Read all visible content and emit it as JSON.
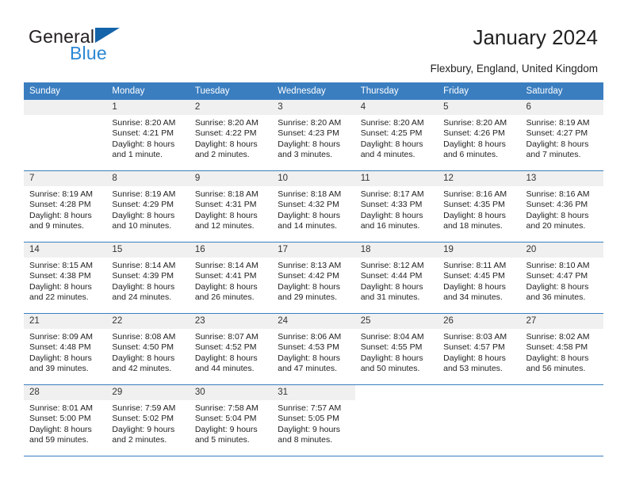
{
  "brand": {
    "name_part1": "General",
    "name_part2": "Blue",
    "flag_icon": "triangle-flag-icon",
    "color_dark": "#231f20",
    "color_blue": "#2b87d4",
    "flag_color": "#1464aa"
  },
  "header": {
    "title": "January 2024",
    "subtitle": "Flexbury, England, United Kingdom",
    "header_bg": "#3a7ec0",
    "daynum_bg": "#f0f0f0"
  },
  "weekdays": [
    "Sunday",
    "Monday",
    "Tuesday",
    "Wednesday",
    "Thursday",
    "Friday",
    "Saturday"
  ],
  "weeks": [
    [
      {
        "day": "",
        "sunrise": "",
        "sunset": "",
        "daylight1": "",
        "daylight2": "",
        "empty": true
      },
      {
        "day": "1",
        "sunrise": "Sunrise: 8:20 AM",
        "sunset": "Sunset: 4:21 PM",
        "daylight1": "Daylight: 8 hours",
        "daylight2": "and 1 minute."
      },
      {
        "day": "2",
        "sunrise": "Sunrise: 8:20 AM",
        "sunset": "Sunset: 4:22 PM",
        "daylight1": "Daylight: 8 hours",
        "daylight2": "and 2 minutes."
      },
      {
        "day": "3",
        "sunrise": "Sunrise: 8:20 AM",
        "sunset": "Sunset: 4:23 PM",
        "daylight1": "Daylight: 8 hours",
        "daylight2": "and 3 minutes."
      },
      {
        "day": "4",
        "sunrise": "Sunrise: 8:20 AM",
        "sunset": "Sunset: 4:25 PM",
        "daylight1": "Daylight: 8 hours",
        "daylight2": "and 4 minutes."
      },
      {
        "day": "5",
        "sunrise": "Sunrise: 8:20 AM",
        "sunset": "Sunset: 4:26 PM",
        "daylight1": "Daylight: 8 hours",
        "daylight2": "and 6 minutes."
      },
      {
        "day": "6",
        "sunrise": "Sunrise: 8:19 AM",
        "sunset": "Sunset: 4:27 PM",
        "daylight1": "Daylight: 8 hours",
        "daylight2": "and 7 minutes."
      }
    ],
    [
      {
        "day": "7",
        "sunrise": "Sunrise: 8:19 AM",
        "sunset": "Sunset: 4:28 PM",
        "daylight1": "Daylight: 8 hours",
        "daylight2": "and 9 minutes."
      },
      {
        "day": "8",
        "sunrise": "Sunrise: 8:19 AM",
        "sunset": "Sunset: 4:29 PM",
        "daylight1": "Daylight: 8 hours",
        "daylight2": "and 10 minutes."
      },
      {
        "day": "9",
        "sunrise": "Sunrise: 8:18 AM",
        "sunset": "Sunset: 4:31 PM",
        "daylight1": "Daylight: 8 hours",
        "daylight2": "and 12 minutes."
      },
      {
        "day": "10",
        "sunrise": "Sunrise: 8:18 AM",
        "sunset": "Sunset: 4:32 PM",
        "daylight1": "Daylight: 8 hours",
        "daylight2": "and 14 minutes."
      },
      {
        "day": "11",
        "sunrise": "Sunrise: 8:17 AM",
        "sunset": "Sunset: 4:33 PM",
        "daylight1": "Daylight: 8 hours",
        "daylight2": "and 16 minutes."
      },
      {
        "day": "12",
        "sunrise": "Sunrise: 8:16 AM",
        "sunset": "Sunset: 4:35 PM",
        "daylight1": "Daylight: 8 hours",
        "daylight2": "and 18 minutes."
      },
      {
        "day": "13",
        "sunrise": "Sunrise: 8:16 AM",
        "sunset": "Sunset: 4:36 PM",
        "daylight1": "Daylight: 8 hours",
        "daylight2": "and 20 minutes."
      }
    ],
    [
      {
        "day": "14",
        "sunrise": "Sunrise: 8:15 AM",
        "sunset": "Sunset: 4:38 PM",
        "daylight1": "Daylight: 8 hours",
        "daylight2": "and 22 minutes."
      },
      {
        "day": "15",
        "sunrise": "Sunrise: 8:14 AM",
        "sunset": "Sunset: 4:39 PM",
        "daylight1": "Daylight: 8 hours",
        "daylight2": "and 24 minutes."
      },
      {
        "day": "16",
        "sunrise": "Sunrise: 8:14 AM",
        "sunset": "Sunset: 4:41 PM",
        "daylight1": "Daylight: 8 hours",
        "daylight2": "and 26 minutes."
      },
      {
        "day": "17",
        "sunrise": "Sunrise: 8:13 AM",
        "sunset": "Sunset: 4:42 PM",
        "daylight1": "Daylight: 8 hours",
        "daylight2": "and 29 minutes."
      },
      {
        "day": "18",
        "sunrise": "Sunrise: 8:12 AM",
        "sunset": "Sunset: 4:44 PM",
        "daylight1": "Daylight: 8 hours",
        "daylight2": "and 31 minutes."
      },
      {
        "day": "19",
        "sunrise": "Sunrise: 8:11 AM",
        "sunset": "Sunset: 4:45 PM",
        "daylight1": "Daylight: 8 hours",
        "daylight2": "and 34 minutes."
      },
      {
        "day": "20",
        "sunrise": "Sunrise: 8:10 AM",
        "sunset": "Sunset: 4:47 PM",
        "daylight1": "Daylight: 8 hours",
        "daylight2": "and 36 minutes."
      }
    ],
    [
      {
        "day": "21",
        "sunrise": "Sunrise: 8:09 AM",
        "sunset": "Sunset: 4:48 PM",
        "daylight1": "Daylight: 8 hours",
        "daylight2": "and 39 minutes."
      },
      {
        "day": "22",
        "sunrise": "Sunrise: 8:08 AM",
        "sunset": "Sunset: 4:50 PM",
        "daylight1": "Daylight: 8 hours",
        "daylight2": "and 42 minutes."
      },
      {
        "day": "23",
        "sunrise": "Sunrise: 8:07 AM",
        "sunset": "Sunset: 4:52 PM",
        "daylight1": "Daylight: 8 hours",
        "daylight2": "and 44 minutes."
      },
      {
        "day": "24",
        "sunrise": "Sunrise: 8:06 AM",
        "sunset": "Sunset: 4:53 PM",
        "daylight1": "Daylight: 8 hours",
        "daylight2": "and 47 minutes."
      },
      {
        "day": "25",
        "sunrise": "Sunrise: 8:04 AM",
        "sunset": "Sunset: 4:55 PM",
        "daylight1": "Daylight: 8 hours",
        "daylight2": "and 50 minutes."
      },
      {
        "day": "26",
        "sunrise": "Sunrise: 8:03 AM",
        "sunset": "Sunset: 4:57 PM",
        "daylight1": "Daylight: 8 hours",
        "daylight2": "and 53 minutes."
      },
      {
        "day": "27",
        "sunrise": "Sunrise: 8:02 AM",
        "sunset": "Sunset: 4:58 PM",
        "daylight1": "Daylight: 8 hours",
        "daylight2": "and 56 minutes."
      }
    ],
    [
      {
        "day": "28",
        "sunrise": "Sunrise: 8:01 AM",
        "sunset": "Sunset: 5:00 PM",
        "daylight1": "Daylight: 8 hours",
        "daylight2": "and 59 minutes."
      },
      {
        "day": "29",
        "sunrise": "Sunrise: 7:59 AM",
        "sunset": "Sunset: 5:02 PM",
        "daylight1": "Daylight: 9 hours",
        "daylight2": "and 2 minutes."
      },
      {
        "day": "30",
        "sunrise": "Sunrise: 7:58 AM",
        "sunset": "Sunset: 5:04 PM",
        "daylight1": "Daylight: 9 hours",
        "daylight2": "and 5 minutes."
      },
      {
        "day": "31",
        "sunrise": "Sunrise: 7:57 AM",
        "sunset": "Sunset: 5:05 PM",
        "daylight1": "Daylight: 9 hours",
        "daylight2": "and 8 minutes."
      },
      {
        "day": "",
        "sunrise": "",
        "sunset": "",
        "daylight1": "",
        "daylight2": "",
        "blank": true
      },
      {
        "day": "",
        "sunrise": "",
        "sunset": "",
        "daylight1": "",
        "daylight2": "",
        "blank": true
      },
      {
        "day": "",
        "sunrise": "",
        "sunset": "",
        "daylight1": "",
        "daylight2": "",
        "blank": true
      }
    ]
  ]
}
